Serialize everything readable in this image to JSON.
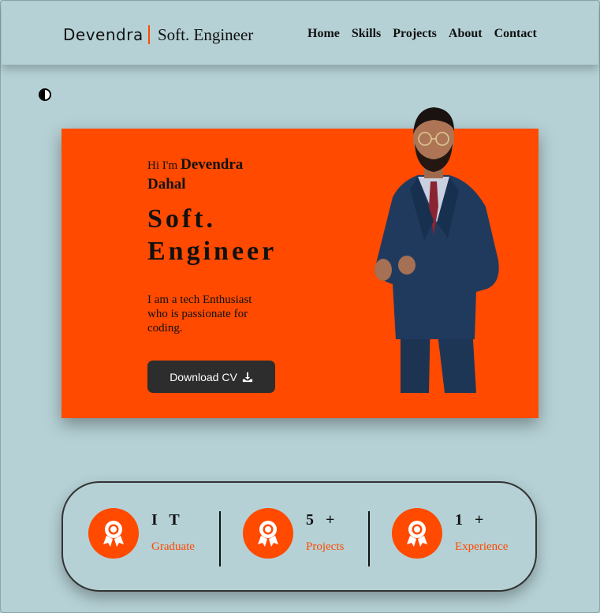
{
  "header": {
    "logo": "Devendra",
    "subtitle": "Soft. Engineer",
    "nav": [
      "Home",
      "Skills",
      "Projects",
      "About",
      "Contact"
    ]
  },
  "theme_toggle_icon": "half-circle-contrast-icon",
  "hero": {
    "greeting_prefix": "Hi I'm",
    "name": "Devendra Dahal",
    "title": "Soft. Engineer",
    "description": "I am a tech Enthusiast who is passionate for coding.",
    "cv_button": "Download CV",
    "cv_icon": "download-icon"
  },
  "stats": [
    {
      "value": "I T",
      "label": "Graduate",
      "icon": "award-icon"
    },
    {
      "value": "5 +",
      "label": "Projects",
      "icon": "award-icon"
    },
    {
      "value": "1 +",
      "label": "Experience",
      "icon": "award-icon"
    }
  ],
  "colors": {
    "accent": "#ff4a00",
    "background": "#b5d1d5",
    "button": "#2d2d2d"
  }
}
